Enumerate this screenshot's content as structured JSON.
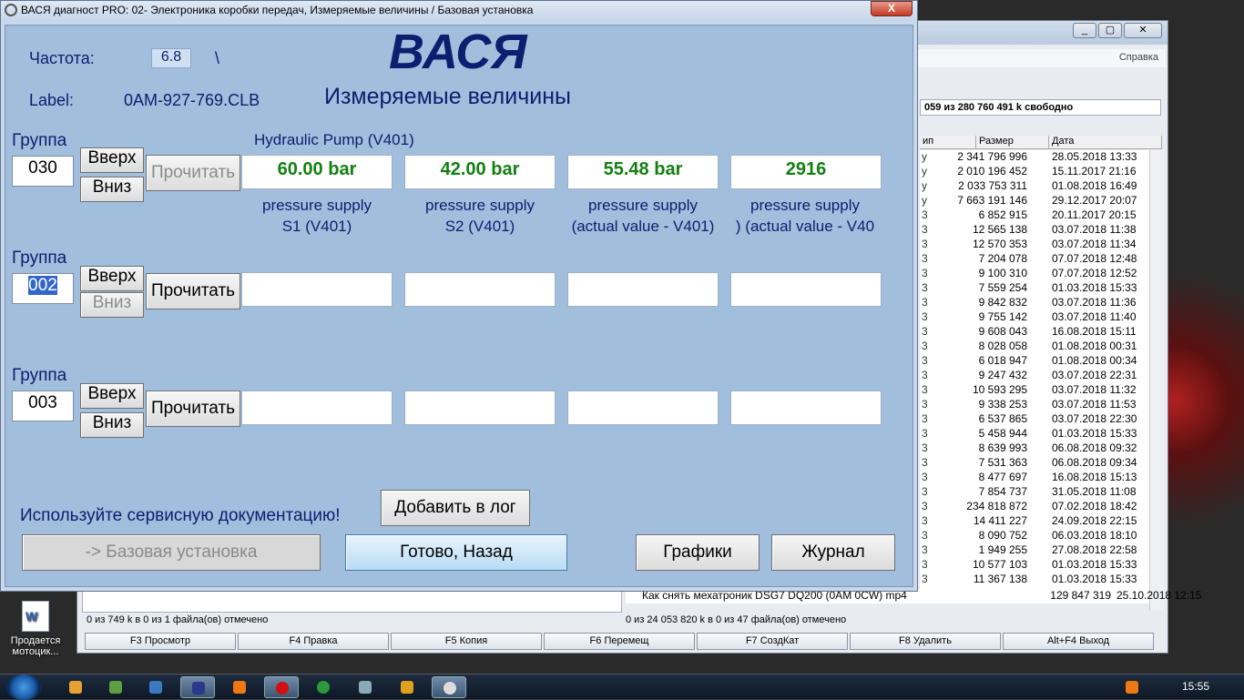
{
  "window": {
    "title": "ВАСЯ диагност PRO: 02- Электроника коробки передач,  Измеряемые величины / Базовая установка",
    "close": "X"
  },
  "header": {
    "freq_label": "Частота:",
    "freq_value": "6.8",
    "freq_mark": "\\",
    "label_label": "Label:",
    "label_value": "0AM-927-769.CLB",
    "app_title": "ВАСЯ",
    "subtitle": "Измеряемые величины"
  },
  "groups": [
    {
      "label": "Группа",
      "value": "030",
      "up": "Вверх",
      "down": "Вниз",
      "read": "Прочитать",
      "name": "Hydraulic Pump (V401)",
      "values": [
        "60.00 bar",
        "42.00 bar",
        "55.48 bar",
        "2916"
      ],
      "descs": [
        [
          "pressure supply",
          "S1 (V401)"
        ],
        [
          "pressure supply",
          "S2 (V401)"
        ],
        [
          "pressure supply",
          "(actual value - V401)"
        ],
        [
          "pressure supply",
          ") (actual value - V40"
        ]
      ]
    },
    {
      "label": "Группа",
      "value": "002",
      "up": "Вверх",
      "down": "Вниз",
      "read": "Прочитать"
    },
    {
      "label": "Группа",
      "value": "003",
      "up": "Вверх",
      "down": "Вниз",
      "read": "Прочитать"
    }
  ],
  "footer": {
    "hint": "Используйте сервисную документацию!",
    "add_log": "Добавить в лог",
    "basic": "-> Базовая установка",
    "done": "Готово, Назад",
    "graphs": "Графики",
    "journal": "Журнал"
  },
  "tc": {
    "help": "Справка",
    "free": "059 из 280 760 491 k свободно",
    "col_type": "ип",
    "col_size": "Размер",
    "col_date": "Дата",
    "rows": [
      [
        "y",
        "2 341 796 996",
        "28.05.2018 13:33"
      ],
      [
        "y",
        "2 010 196 452",
        "15.11.2017 21:16"
      ],
      [
        "y",
        "2 033 753 311",
        "01.08.2018 16:49"
      ],
      [
        "y",
        "7 663 191 146",
        "29.12.2017 20:07"
      ],
      [
        "3",
        "6 852 915",
        "20.11.2017 20:15"
      ],
      [
        "3",
        "12 565 138",
        "03.07.2018 11:38"
      ],
      [
        "3",
        "12 570 353",
        "03.07.2018 11:34"
      ],
      [
        "3",
        "7 204 078",
        "07.07.2018 12:48"
      ],
      [
        "3",
        "9 100 310",
        "07.07.2018 12:52"
      ],
      [
        "3",
        "7 559 254",
        "01.03.2018 15:33"
      ],
      [
        "3",
        "9 842 832",
        "03.07.2018 11:36"
      ],
      [
        "3",
        "9 755 142",
        "03.07.2018 11:40"
      ],
      [
        "3",
        "9 608 043",
        "16.08.2018 15:11"
      ],
      [
        "3",
        "8 028 058",
        "01.08.2018 00:31"
      ],
      [
        "3",
        "6 018 947",
        "01.08.2018 00:34"
      ],
      [
        "3",
        "9 247 432",
        "03.07.2018 22:31"
      ],
      [
        "3",
        "10 593 295",
        "03.07.2018 11:32"
      ],
      [
        "3",
        "9 338 253",
        "03.07.2018 11:53"
      ],
      [
        "3",
        "6 537 865",
        "03.07.2018 22:30"
      ],
      [
        "3",
        "5 458 944",
        "01.03.2018 15:33"
      ],
      [
        "3",
        "8 639 993",
        "06.08.2018 09:32"
      ],
      [
        "3",
        "7 531 363",
        "06.08.2018 09:34"
      ],
      [
        "3",
        "8 477 697",
        "16.08.2018 15:13"
      ],
      [
        "3",
        "7 854 737",
        "31.05.2018 11:08"
      ],
      [
        "3",
        "234 818 872",
        "07.02.2018 18:42"
      ],
      [
        "3",
        "14 411 227",
        "24.09.2018 22:15"
      ],
      [
        "3",
        "8 090 752",
        "06.03.2018 18:10"
      ],
      [
        "3",
        "1 949 255",
        "27.08.2018 22:58"
      ],
      [
        "3",
        "10 577 103",
        "01.03.2018 15:33"
      ],
      [
        "3",
        "11 367 138",
        "01.03.2018 15:33"
      ]
    ],
    "last_name": "Как снять мехатроник DSG7 DQ200 (0AM 0CW) mp4",
    "last_size": "129 847 319",
    "last_date": "25.10.2018 12:15",
    "status_left": "0 из 749 k в 0 из 1 файла(ов) отмечено",
    "status_right": "0 из 24 053 820 k в 0 из 47 файла(ов) отмечено",
    "fkeys": [
      "F3 Просмотр",
      "F4 Правка",
      "F5 Копия",
      "F6 Перемещ",
      "F7 СоздКат",
      "F8 Удалить",
      "Alt+F4 Выход"
    ]
  },
  "desktop": {
    "icon_label": "Продается мотоцик..."
  },
  "taskbar": {
    "clock": "15:55"
  }
}
